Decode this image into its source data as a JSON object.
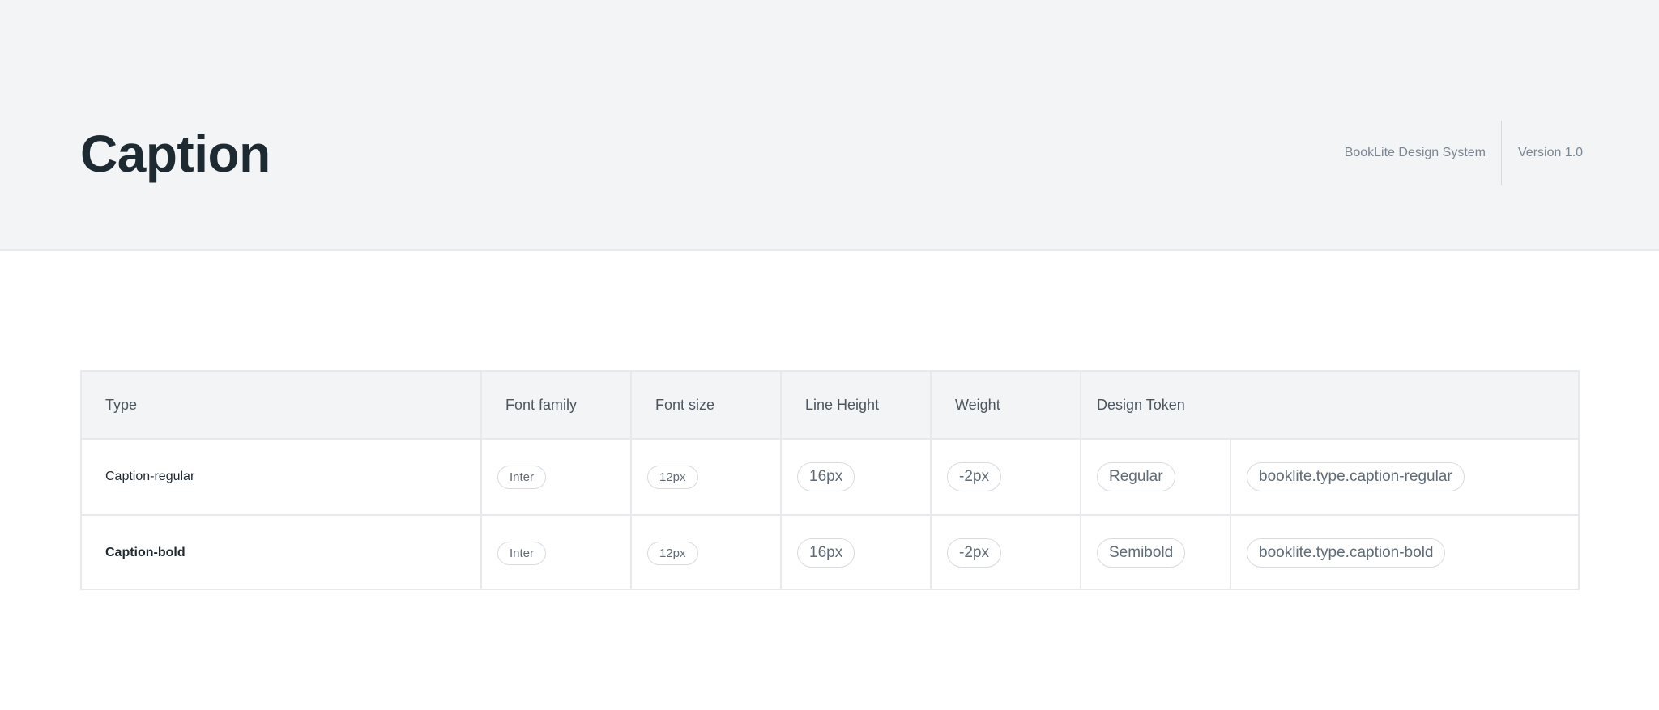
{
  "header": {
    "title": "Caption",
    "system_name": "BookLite Design System",
    "version": "Version 1.0"
  },
  "table": {
    "columns": [
      "Type",
      "Font family",
      "Font size",
      "Line Height",
      "Weight",
      "Design Token"
    ],
    "rows": [
      {
        "type": "Caption-regular",
        "font_family": "Inter",
        "font_size": "12px",
        "line_height": "16px",
        "letter_spacing": "-2px",
        "weight": "Regular",
        "token": "booklite.type.caption-regular"
      },
      {
        "type": "Caption-bold",
        "font_family": "Inter",
        "font_size": "12px",
        "line_height": "16px",
        "letter_spacing": "-2px",
        "weight": "Semibold",
        "token": "booklite.type.caption-bold"
      }
    ]
  }
}
